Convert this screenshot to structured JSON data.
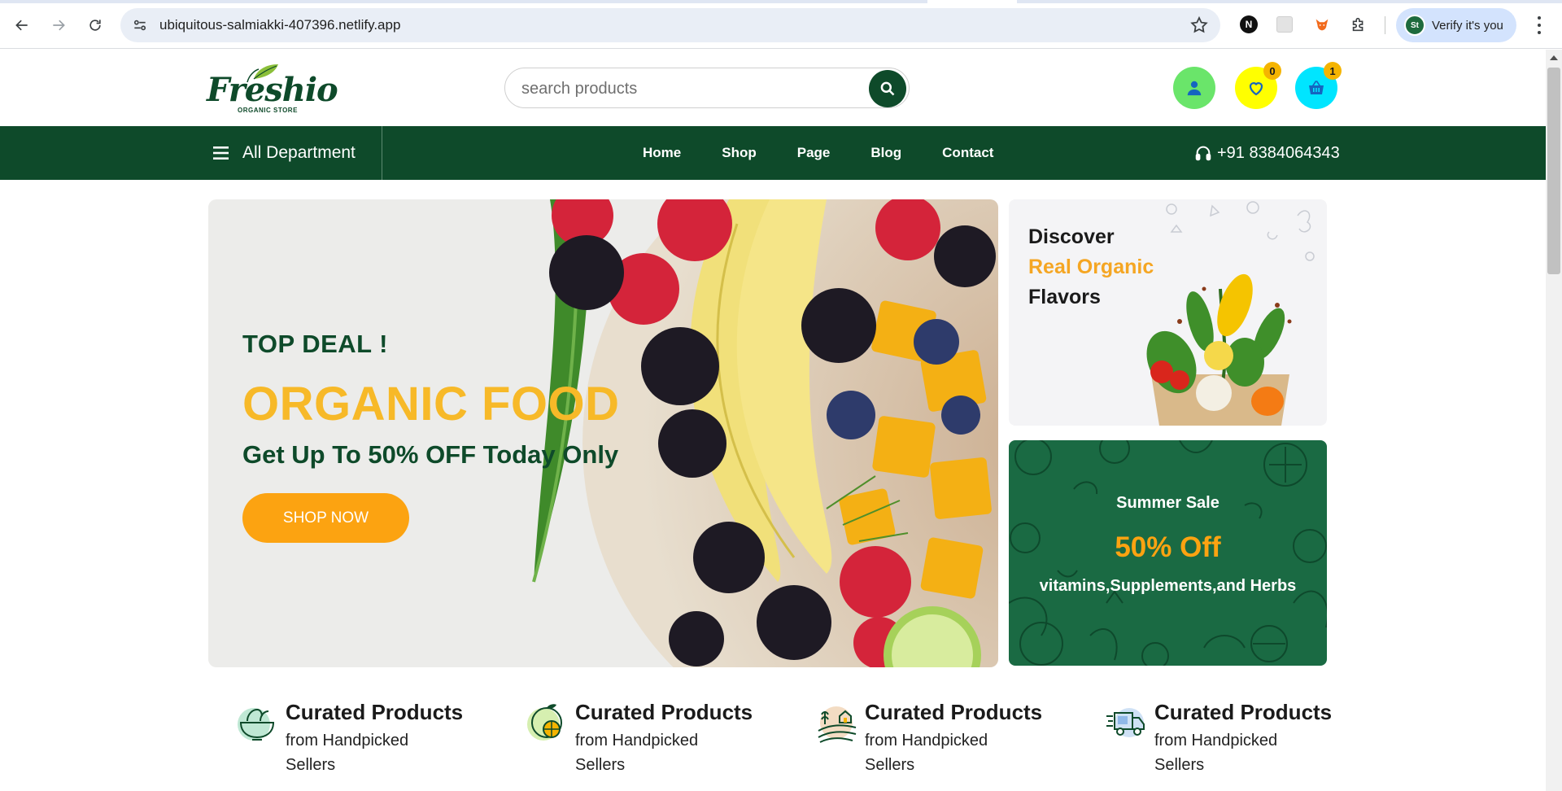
{
  "browser": {
    "url": "ubiquitous-salmiakki-407396.netlify.app",
    "profile_label": "Verify it's you",
    "profile_initials": "St",
    "icons": [
      "back-icon",
      "forward-icon",
      "reload-icon",
      "site-settings-icon",
      "bookmark-star-icon",
      "extension-icon",
      "menu-icon"
    ]
  },
  "header": {
    "logo_text": "Freshio",
    "logo_subtext": "ORGANIC STORE",
    "search_placeholder": "search products",
    "wishlist_count": "0",
    "cart_count": "1",
    "colors": {
      "brand_green": "#0e4a2a",
      "accent_yellow": "#f7b928",
      "accent_orange": "#fca311"
    }
  },
  "navbar": {
    "department_label": "All Department",
    "links": [
      "Home",
      "Shop",
      "Page",
      "Blog",
      "Contact"
    ],
    "phone": "+91 8384064343"
  },
  "hero": {
    "kicker": "TOP DEAL !",
    "title": "ORGANIC FOOD",
    "subtitle": "Get Up To 50% OFF Today Only",
    "cta": "SHOP NOW"
  },
  "side_banner_1": {
    "line1": "Discover",
    "line2": "Real Organic",
    "line3": "Flavors"
  },
  "side_banner_2": {
    "label": "Summer Sale",
    "discount": "50% Off",
    "caption": "vitamins,Supplements,and Herbs"
  },
  "features": [
    {
      "title": "Curated Products",
      "desc": "from Handpicked Sellers",
      "icon": "salad-bowl-icon"
    },
    {
      "title": "Curated Products",
      "desc": "from Handpicked Sellers",
      "icon": "citrus-icon"
    },
    {
      "title": "Curated Products",
      "desc": "from Handpicked Sellers",
      "icon": "farm-icon"
    },
    {
      "title": "Curated Products",
      "desc": "from Handpicked Sellers",
      "icon": "delivery-truck-icon"
    }
  ]
}
